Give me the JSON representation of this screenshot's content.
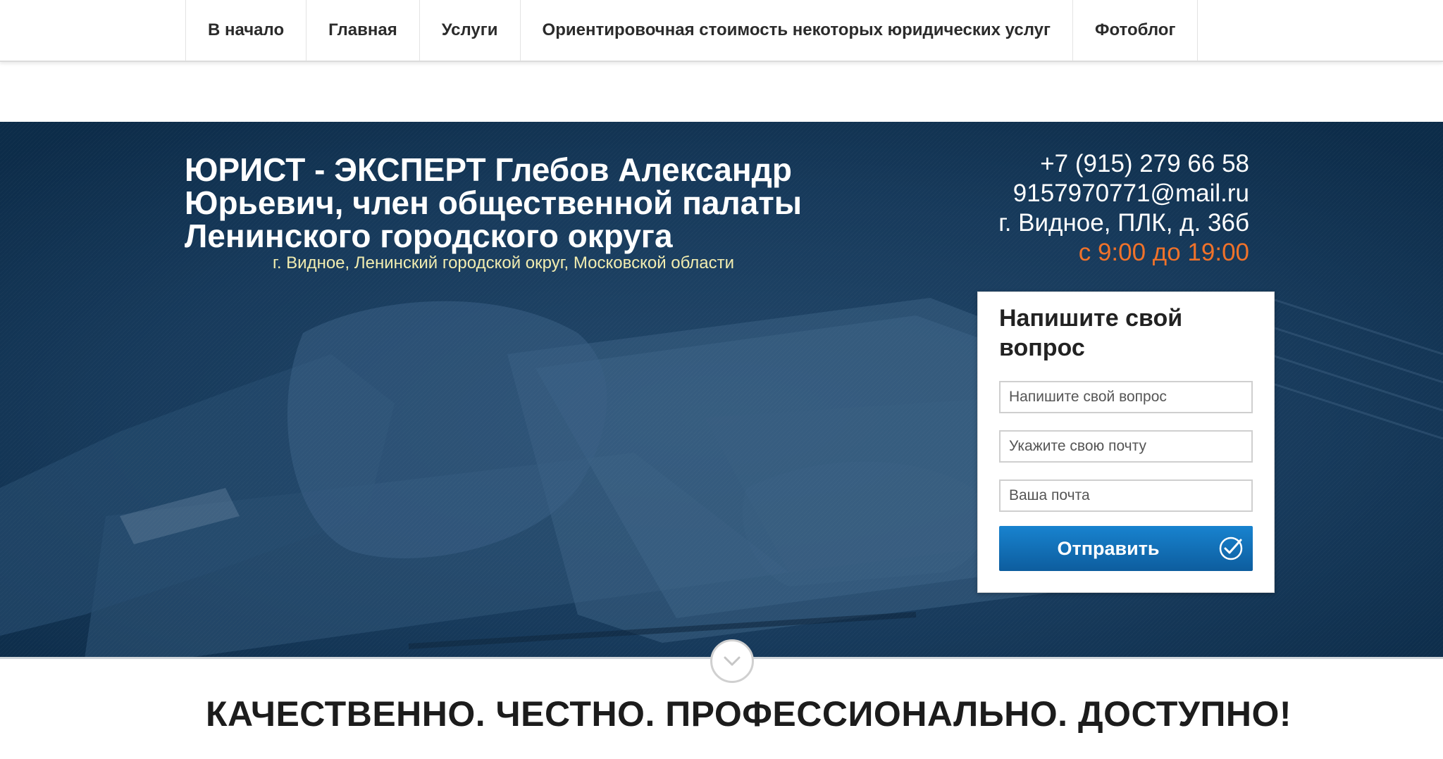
{
  "nav": {
    "items": [
      {
        "label": "В начало"
      },
      {
        "label": "Главная"
      },
      {
        "label": "Услуги"
      },
      {
        "label": "Ориентировочная стоимость некоторых юридических услуг"
      },
      {
        "label": "Фотоблог"
      }
    ]
  },
  "hero": {
    "title": "ЮРИСТ - ЭКСПЕРТ Глебов Александр Юрьевич, член общественной палаты Ленинского городского округа",
    "subtitle": "г. Видное, Ленинский городской округ, Московской области"
  },
  "contacts": {
    "phone": "+7 (915) 279 66 58",
    "email": "9157970771@mail.ru",
    "address": "г. Видное, ПЛК, д. 36б",
    "hours": "с 9:00 до 19:00"
  },
  "form": {
    "title": "Напишите свой вопрос",
    "question_placeholder": "Напишите свой вопрос",
    "email_placeholder": "Укажите свою почту",
    "email2_placeholder": "Ваша почта",
    "submit_label": "Отправить"
  },
  "slogan": "КАЧЕСТВЕННО. ЧЕСТНО. ПРОФЕССИОНАЛЬНО. ДОСТУПНО!",
  "colors": {
    "hero_bg": "#0f3150",
    "hours_accent": "#f0722a",
    "subtitle": "#f2edb0",
    "button": "#1377c4"
  },
  "icons": {
    "submit": "check-circle-icon",
    "scroll": "chevron-down-icon"
  }
}
